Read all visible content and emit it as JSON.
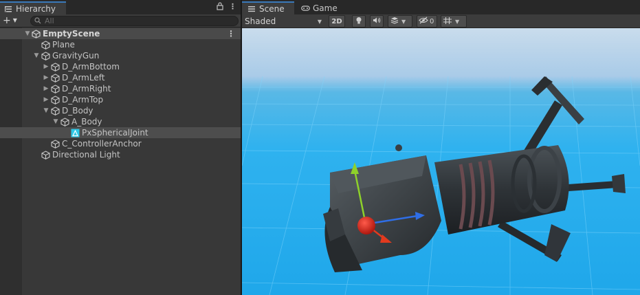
{
  "hierarchy": {
    "tab_label": "Hierarchy",
    "search_placeholder": "All",
    "scene_name": "EmptyScene",
    "items": [
      {
        "label": "Plane"
      },
      {
        "label": "GravityGun"
      },
      {
        "label": "D_ArmBottom"
      },
      {
        "label": "D_ArmLeft"
      },
      {
        "label": "D_ArmRight"
      },
      {
        "label": "D_ArmTop"
      },
      {
        "label": "D_Body"
      },
      {
        "label": "A_Body"
      },
      {
        "label": "PxSphericalJoint"
      },
      {
        "label": "C_ControllerAnchor"
      },
      {
        "label": "Directional Light"
      }
    ]
  },
  "scene_view": {
    "tabs": [
      {
        "label": "Scene"
      },
      {
        "label": "Game"
      }
    ],
    "shading_mode": "Shaded",
    "toggle_2d": "2D",
    "hidden_count": "0"
  },
  "colors": {
    "accent": "#3a79bb",
    "sky": "#1fa7ea",
    "joint_icon": "#2ec8e6",
    "gizmo_x": "#e23a1e",
    "gizmo_y": "#8ed12a",
    "gizmo_z": "#2f6ee6"
  },
  "icons": [
    "hierarchy-icon",
    "lock-icon",
    "menu-icon",
    "plus-icon",
    "search-icon",
    "cube-icon",
    "unity-scene-icon",
    "joint-icon",
    "scene-icon",
    "game-icon",
    "light-icon",
    "audio-icon",
    "effects-icon",
    "visibility-icon",
    "grid-icon"
  ]
}
